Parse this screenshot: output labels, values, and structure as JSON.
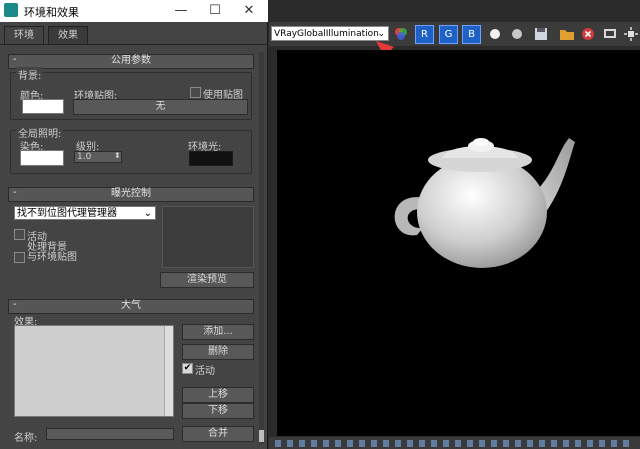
{
  "dialog": {
    "title": "环境和效果",
    "window_controls": {
      "minimize": "—",
      "maximize": "☐",
      "close": "✕"
    },
    "tabs": [
      {
        "label": "环境",
        "active": true
      },
      {
        "label": "效果",
        "active": false
      }
    ],
    "common": {
      "header": "公用参数",
      "collapse": "-",
      "background_group": "背景:",
      "color_label": "颜色:",
      "env_map_label": "环境贴图:",
      "use_map_label": "使用贴图",
      "env_map_button": "无",
      "global_illum_group": "全局照明:",
      "tint_label": "染色:",
      "level_label": "级别:",
      "level_value": "1.0",
      "ambient_label": "环境光:"
    },
    "exposure": {
      "header": "曝光控制",
      "collapse": "-",
      "dropdown_value": "找不到位图代理管理器",
      "active_label": "活动",
      "process_bg_line1": "处理背景",
      "process_bg_line2": "与环境贴图",
      "render_preview": "渲染预览"
    },
    "atmosphere": {
      "header": "大气",
      "collapse": "-",
      "effects_label": "效果:",
      "add": "添加...",
      "delete": "删除",
      "active_label": "活动",
      "move_up": "上移",
      "move_down": "下移",
      "name_label": "名称:",
      "merge": "合并"
    }
  },
  "toolbar": {
    "renderer_select": "VRayGlobalIllumination",
    "channels": [
      "R",
      "G",
      "B"
    ],
    "icons": [
      "color-swatch-icon",
      "white-dot-icon",
      "gray-dot-icon",
      "save-icon",
      "folder-icon",
      "close-circle-icon",
      "display-icon",
      "expand-icon"
    ]
  },
  "colors": {
    "accent_blue": "#1e62c8",
    "annotation_arrow": "#e53935",
    "viewport_bg": "#000000"
  }
}
